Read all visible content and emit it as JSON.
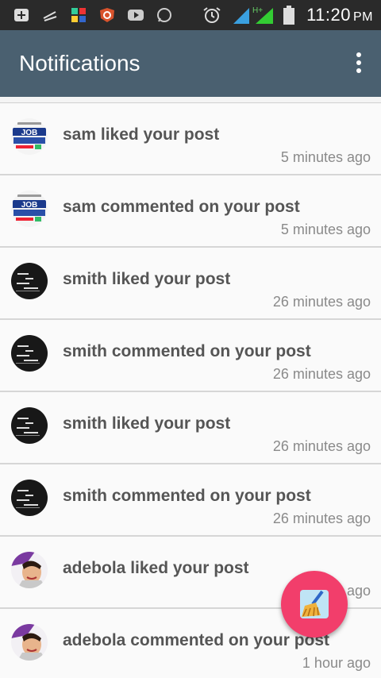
{
  "status_bar": {
    "time": "11:20",
    "ampm": "PM",
    "network": "H+",
    "icons": [
      "plus-square-icon",
      "pen-icon",
      "app-icon",
      "antivirus-icon",
      "youtube-icon",
      "whatsapp-icon",
      "alarm-icon",
      "signal-icon",
      "battery-icon"
    ]
  },
  "app_bar": {
    "title": "Notifications"
  },
  "notifications": [
    {
      "message": "sam liked your post",
      "time": "5 minutes ago",
      "avatar": "job-logo-avatar"
    },
    {
      "message": "sam commented on your post",
      "time": "5 minutes ago",
      "avatar": "job-logo-avatar"
    },
    {
      "message": "smith liked your post",
      "time": "26 minutes ago",
      "avatar": "struggle-text-avatar"
    },
    {
      "message": "smith commented on your post",
      "time": "26 minutes ago",
      "avatar": "struggle-text-avatar"
    },
    {
      "message": "smith liked your post",
      "time": "26 minutes ago",
      "avatar": "struggle-text-avatar"
    },
    {
      "message": "smith commented on your post",
      "time": "26 minutes ago",
      "avatar": "struggle-text-avatar"
    },
    {
      "message": "adebola liked your post",
      "time": "1 hour ago",
      "avatar": "cartoon-avatar"
    },
    {
      "message": "adebola commented on your post",
      "time": "1 hour ago",
      "avatar": "cartoon-avatar"
    }
  ],
  "fab": {
    "icon": "broom-icon"
  },
  "colors": {
    "app_bar": "#4a6070",
    "status_bar": "#2a2a2a",
    "fab": "#f23e6b",
    "text": "#555555",
    "time_text": "#8a8a8a"
  }
}
